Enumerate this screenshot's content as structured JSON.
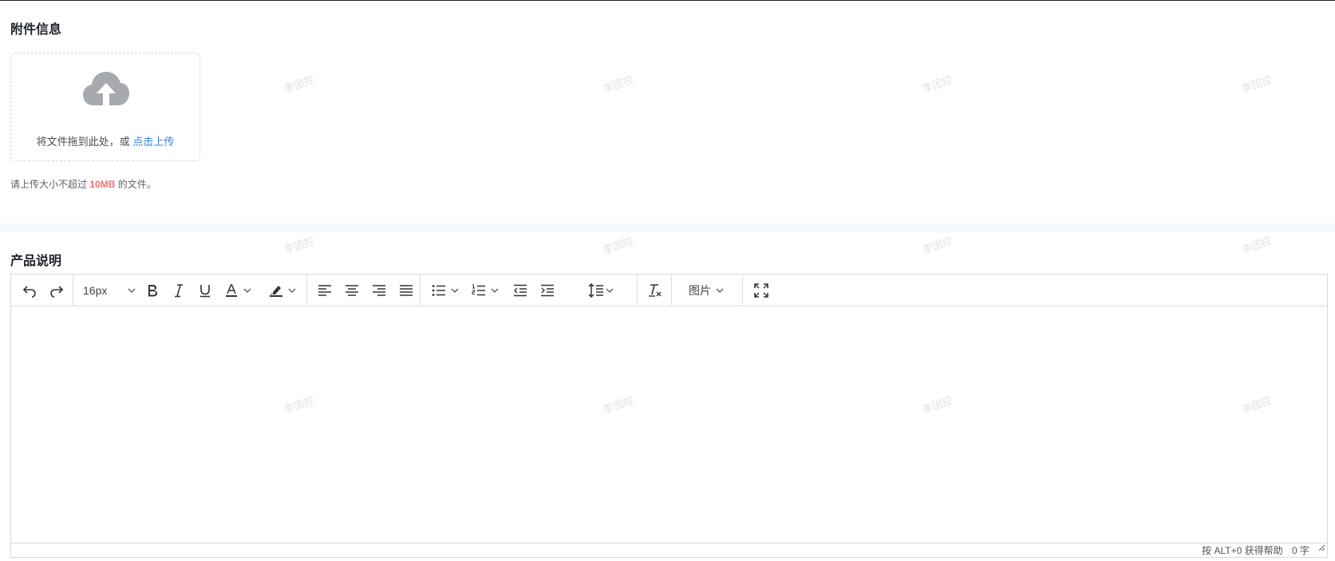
{
  "attachments": {
    "title": "附件信息",
    "upload_text": "将文件拖到此处，或",
    "upload_link": "点击上传",
    "tip_prefix": "请上传大小不超过",
    "tip_size": "10MB",
    "tip_suffix": "的文件。"
  },
  "product_desc": {
    "title": "产品说明"
  },
  "toolbar": {
    "font_size": "16px",
    "image_label": "图片"
  },
  "statusbar": {
    "help_text": "按 ALT+0 获得帮助",
    "word_count": "0 字"
  },
  "watermark": {
    "text": "李团控"
  },
  "colors": {
    "accent_link": "#3f7fd6",
    "size_highlight": "#f56c6c",
    "icon_gray": "#a6a9ae"
  }
}
